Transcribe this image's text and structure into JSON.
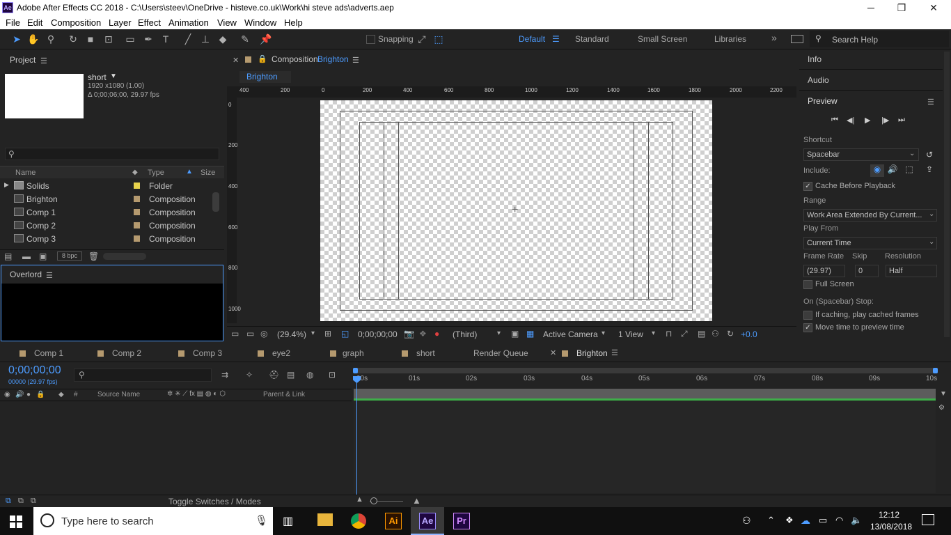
{
  "window": {
    "title": "Adobe After Effects CC 2018 - C:\\Users\\steev\\OneDrive - histeve.co.uk\\Work\\hi steve ads\\adverts.aep",
    "minimize": "─",
    "maximize": "❐",
    "close": "✕",
    "app_badge": "Ae"
  },
  "menu": [
    "File",
    "Edit",
    "Composition",
    "Layer",
    "Effect",
    "Animation",
    "View",
    "Window",
    "Help"
  ],
  "toolbar": {
    "snapping": "Snapping",
    "workspaces": [
      "Default",
      "Standard",
      "Small Screen",
      "Libraries"
    ],
    "more": "»",
    "search_placeholder": "Search Help"
  },
  "project": {
    "title": "Project",
    "item_name": "short",
    "item_dims": "1920 x1080 (1.00)",
    "item_duration": "Δ 0;00;06;00, 29.97 fps",
    "search_icon": "⚲",
    "columns": {
      "name": "Name",
      "type": "Type",
      "size": "Size"
    },
    "bpc": "8 bpc",
    "rows": [
      {
        "name": "Solids",
        "type": "Folder",
        "label_color": "#e8d34c"
      },
      {
        "name": "Brighton",
        "type": "Composition",
        "label_color": "#b59a6f"
      },
      {
        "name": "Comp 1",
        "type": "Composition",
        "label_color": "#b59a6f"
      },
      {
        "name": "Comp 2",
        "type": "Composition",
        "label_color": "#b59a6f"
      },
      {
        "name": "Comp 3",
        "type": "Composition",
        "label_color": "#b59a6f"
      }
    ]
  },
  "overlord": {
    "title": "Overlord"
  },
  "composition": {
    "label": "Composition",
    "name": "Brighton",
    "crumb": "Brighton",
    "ruler_top": [
      "400",
      "200",
      "0",
      "200",
      "400",
      "600",
      "800",
      "1000",
      "1200",
      "1400",
      "1600",
      "1800",
      "2000",
      "2200"
    ],
    "ruler_left": [
      "0",
      "200",
      "400",
      "600",
      "800",
      "1000"
    ],
    "footer": {
      "zoom": "(29.4%)",
      "timecode": "0;00;00;00",
      "res": "(Third)",
      "camera": "Active Camera",
      "views": "1 View",
      "exposure": "+0.0"
    }
  },
  "right": {
    "info": "Info",
    "audio": "Audio",
    "preview": "Preview",
    "shortcut_label": "Shortcut",
    "shortcut": "Spacebar",
    "include": "Include:",
    "cache": "Cache Before Playback",
    "range_label": "Range",
    "range": "Work Area Extended By Current...",
    "play_from_label": "Play From",
    "play_from": "Current Time",
    "frame_rate_label": "Frame Rate",
    "skip_label": "Skip",
    "resolution_label": "Resolution",
    "frame_rate": "(29.97)",
    "skip": "0",
    "resolution": "Half",
    "full_screen": "Full Screen",
    "stop_label": "On (Spacebar) Stop:",
    "if_caching": "If caching, play cached frames",
    "move_time": "Move time to preview time"
  },
  "timeline": {
    "tabs": [
      "Comp 1",
      "Comp 2",
      "Comp 3",
      "eye2",
      "graph",
      "short",
      "Render Queue",
      "Brighton"
    ],
    "timecode": "0;00;00;00",
    "frames": "00000 (29.97 fps)",
    "source_name": "Source Name",
    "parent_link": "Parent & Link",
    "hash": "#",
    "ticks": [
      "00s",
      "01s",
      "02s",
      "03s",
      "04s",
      "05s",
      "06s",
      "07s",
      "08s",
      "09s",
      "10s"
    ],
    "toggle": "Toggle Switches / Modes"
  },
  "taskbar": {
    "search": "Type here to search",
    "time": "12:12",
    "date": "13/08/2018"
  }
}
